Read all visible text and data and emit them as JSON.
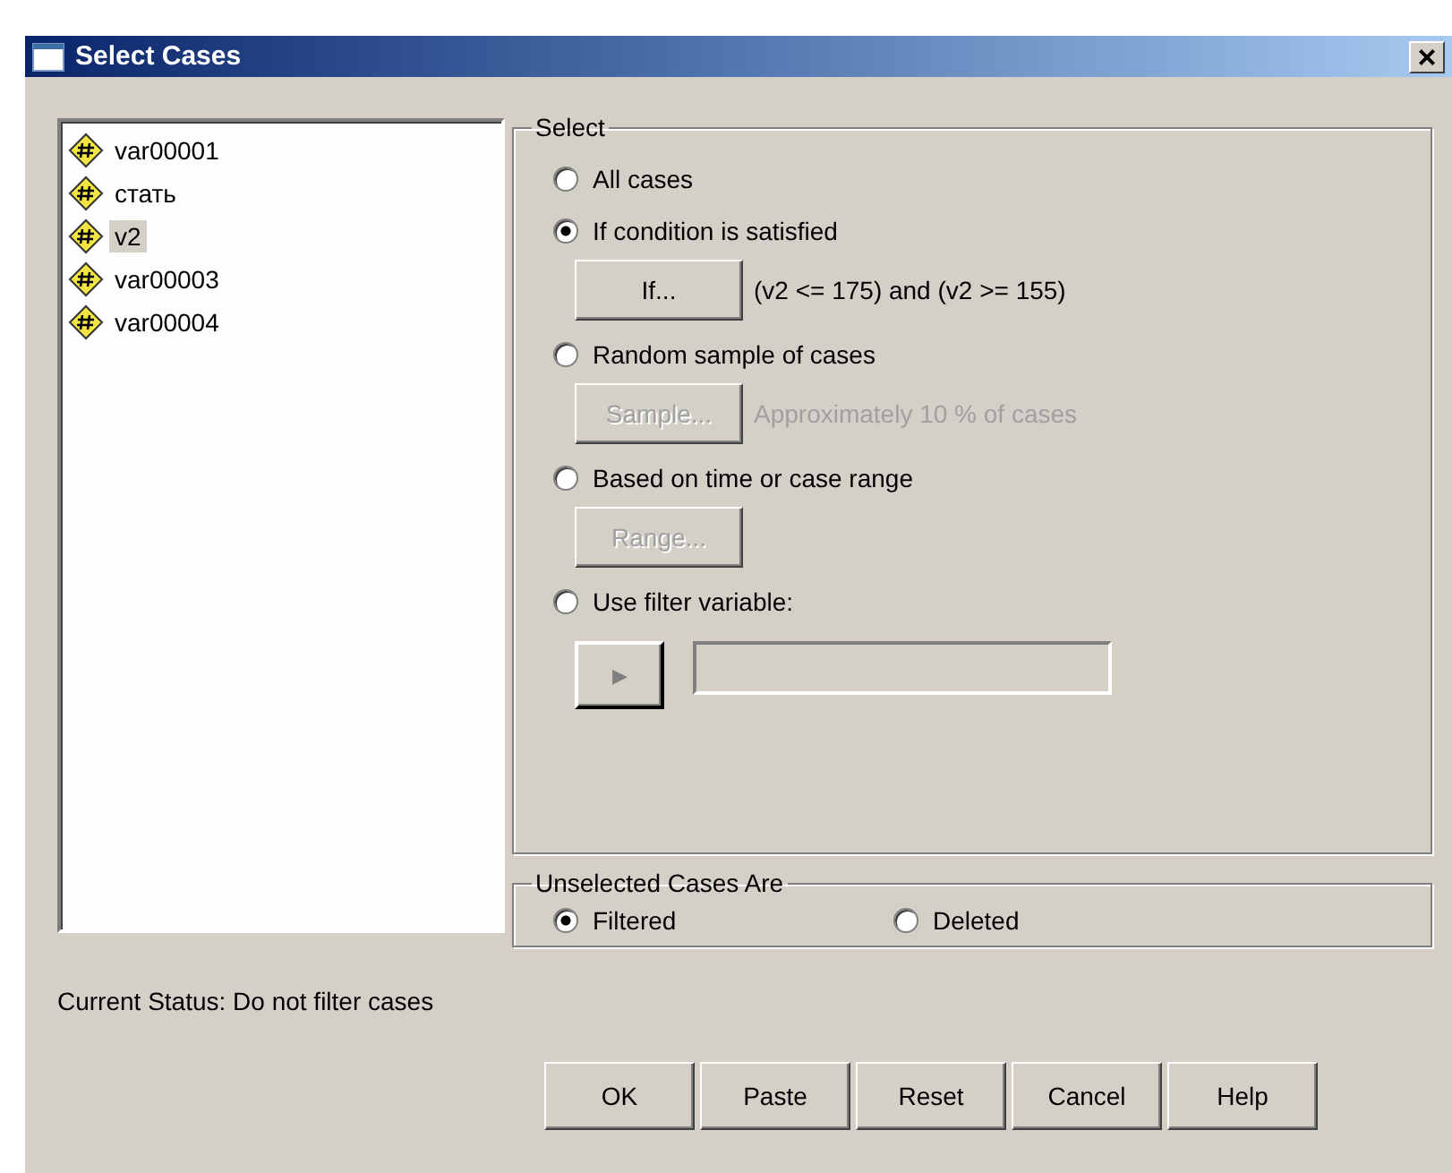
{
  "window": {
    "title": "Select Cases",
    "close_label": "×"
  },
  "variables": [
    {
      "name": "var00001",
      "selected": false
    },
    {
      "name": "стать",
      "selected": false
    },
    {
      "name": "v2",
      "selected": true
    },
    {
      "name": "var00003",
      "selected": false
    },
    {
      "name": "var00004",
      "selected": false
    }
  ],
  "select": {
    "title": "Select",
    "options": [
      {
        "kind": "plain",
        "label": "All cases",
        "selected": false
      },
      {
        "kind": "button",
        "label": "If condition is satisfied",
        "selected": true,
        "button": {
          "label": "If...",
          "disabled": false
        },
        "note": "(v2 <= 175) and (v2 >= 155)"
      },
      {
        "kind": "button",
        "label": "Random sample of cases",
        "selected": false,
        "button": {
          "label": "Sample...",
          "disabled": true
        },
        "note": "Approximately 10 % of cases"
      },
      {
        "kind": "button",
        "label": "Based on time or case range",
        "selected": false,
        "button": {
          "label": "Range...",
          "disabled": true
        }
      },
      {
        "kind": "filter",
        "label": "Use filter variable:",
        "selected": false,
        "arrow": "▶"
      }
    ]
  },
  "unselected": {
    "title": "Unselected Cases Are",
    "options": [
      {
        "label": "Filtered",
        "selected": true
      },
      {
        "label": "Deleted",
        "selected": false
      }
    ]
  },
  "status": "Current Status: Do not filter cases",
  "buttons": [
    "OK",
    "Paste",
    "Reset",
    "Cancel",
    "Help"
  ]
}
